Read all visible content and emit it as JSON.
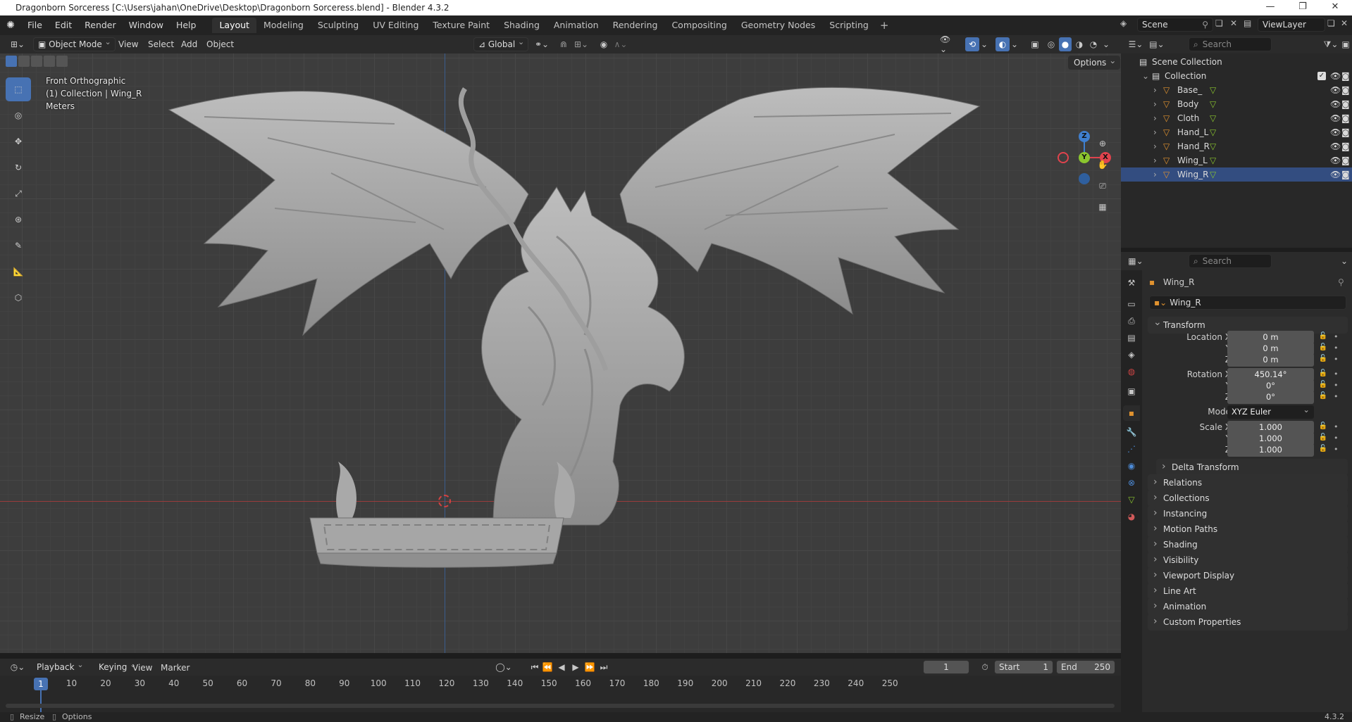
{
  "titlebar": {
    "title": "Dragonborn Sorceress [C:\\Users\\jahan\\OneDrive\\Desktop\\Dragonborn Sorceress.blend] - Blender 4.3.2"
  },
  "menus": [
    "File",
    "Edit",
    "Render",
    "Window",
    "Help"
  ],
  "workspaces": [
    {
      "label": "Layout",
      "active": true
    },
    {
      "label": "Modeling"
    },
    {
      "label": "Sculpting"
    },
    {
      "label": "UV Editing"
    },
    {
      "label": "Texture Paint"
    },
    {
      "label": "Shading"
    },
    {
      "label": "Animation"
    },
    {
      "label": "Rendering"
    },
    {
      "label": "Compositing"
    },
    {
      "label": "Geometry Nodes"
    },
    {
      "label": "Scripting"
    }
  ],
  "scene": {
    "name": "Scene",
    "view_layer": "ViewLayer"
  },
  "viewport_header": {
    "mode": "Object Mode",
    "menus": [
      "View",
      "Select",
      "Add",
      "Object"
    ],
    "orientation": "Global",
    "options": "Options"
  },
  "viewport": {
    "view_name": "Front Orthographic",
    "collection_info": "(1) Collection | Wing_R",
    "units": "Meters"
  },
  "outliner": {
    "search_placeholder": "Search",
    "root": "Scene Collection",
    "collection": "Collection",
    "objects": [
      "Base_",
      "Body",
      "Cloth",
      "Hand_L",
      "Hand_R",
      "Wing_L",
      "Wing_R"
    ]
  },
  "properties": {
    "search_placeholder": "Search",
    "object_name": "Wing_R",
    "datablock_name": "Wing_R",
    "transform_label": "Transform",
    "location": {
      "label": "Location X",
      "x": "0 m",
      "y": "0 m",
      "z": "0 m"
    },
    "rotation": {
      "label": "Rotation X",
      "x": "450.14°",
      "y": "0°",
      "z": "0°"
    },
    "mode_label": "Mode",
    "mode_value": "XYZ Euler",
    "scale": {
      "label": "Scale X",
      "x": "1.000",
      "y": "1.000",
      "z": "1.000"
    },
    "axis_y": "Y",
    "axis_z": "Z",
    "delta_transform": "Delta Transform",
    "panels": [
      "Relations",
      "Collections",
      "Instancing",
      "Motion Paths",
      "Shading",
      "Visibility",
      "Viewport Display",
      "Line Art",
      "Animation",
      "Custom Properties"
    ]
  },
  "timeline_header": {
    "menus": [
      "Playback",
      "Keying",
      "View",
      "Marker"
    ],
    "current_frame": "1",
    "start_label": "Start",
    "start_value": "1",
    "end_label": "End",
    "end_value": "250"
  },
  "timeline": {
    "playhead": "1",
    "ticks": [
      "10",
      "20",
      "30",
      "40",
      "50",
      "60",
      "70",
      "80",
      "90",
      "100",
      "110",
      "120",
      "130",
      "140",
      "150",
      "160",
      "170",
      "180",
      "190",
      "200",
      "210",
      "220",
      "230",
      "240",
      "250"
    ]
  },
  "statusbar": {
    "resize": "Resize",
    "options": "Options",
    "version": "4.3.2"
  },
  "gizmo": {
    "z": "Z",
    "y": "Y",
    "x": "X"
  },
  "colors": {
    "accent": "#4772b3",
    "x_axis": "#e0434d",
    "y_axis": "#8ac52e",
    "z_axis": "#3f7fcf",
    "mesh_icon": "#e0922f"
  }
}
